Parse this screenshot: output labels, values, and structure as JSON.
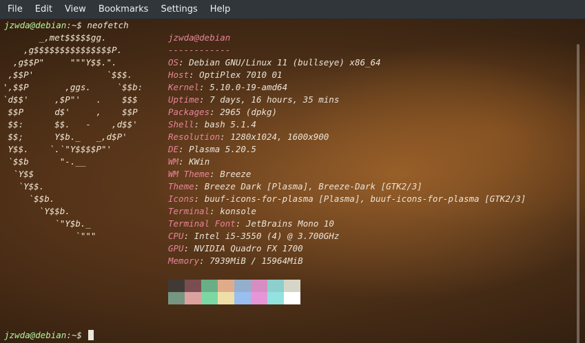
{
  "menubar": {
    "items": [
      "File",
      "Edit",
      "View",
      "Bookmarks",
      "Settings",
      "Help"
    ]
  },
  "prompt": {
    "user": "jzwda@debian",
    "path": ":~$ ",
    "command": "neofetch"
  },
  "logo": [
    "       _,met$$$$$gg.",
    "    ,g$$$$$$$$$$$$$$$P.",
    "  ,g$$P\"     \"\"\"Y$$.\".",
    " ,$$P'              `$$$.",
    "',$$P       ,ggs.     `$$b:",
    "`d$$'     ,$P\"'   .    $$$",
    " $$P      d$'     ,    $$P",
    " $$:      $$.   -    ,d$$'",
    " $$;      Y$b._   _,d$P'",
    " Y$$.    `.`\"Y$$$$P\"'",
    " `$$b      \"-.__",
    "  `Y$$",
    "   `Y$$.",
    "     `$$b.",
    "       `Y$$b.",
    "          `\"Y$b._",
    "              `\"\"\""
  ],
  "info": {
    "title": "jzwda@debian",
    "separator": "------------",
    "lines": [
      {
        "label": "OS",
        "value": "Debian GNU/Linux 11 (bullseye) x86_64"
      },
      {
        "label": "Host",
        "value": "OptiPlex 7010 01"
      },
      {
        "label": "Kernel",
        "value": "5.10.0-19-amd64"
      },
      {
        "label": "Uptime",
        "value": "7 days, 16 hours, 35 mins"
      },
      {
        "label": "Packages",
        "value": "2965 (dpkg)"
      },
      {
        "label": "Shell",
        "value": "bash 5.1.4"
      },
      {
        "label": "Resolution",
        "value": "1280x1024, 1600x900"
      },
      {
        "label": "DE",
        "value": "Plasma 5.20.5"
      },
      {
        "label": "WM",
        "value": "KWin"
      },
      {
        "label": "WM Theme",
        "value": "Breeze"
      },
      {
        "label": "Theme",
        "value": "Breeze Dark [Plasma], Breeze-Dark [GTK2/3]"
      },
      {
        "label": "Icons",
        "value": "buuf-icons-for-plasma [Plasma], buuf-icons-for-plasma [GTK2/3]"
      },
      {
        "label": "Terminal",
        "value": "konsole"
      },
      {
        "label": "Terminal Font",
        "value": "JetBrains Mono 10"
      },
      {
        "label": "CPU",
        "value": "Intel i5-3550 (4) @ 3.700GHz"
      },
      {
        "label": "GPU",
        "value": "NVIDIA Quadro FX 1700"
      },
      {
        "label": "Memory",
        "value": "7939MiB / 15964MiB"
      }
    ]
  },
  "palette": {
    "normal": [
      "#403a36",
      "#7a4e50",
      "#6aae86",
      "#e0ab8a",
      "#94afcc",
      "#d68ec2",
      "#8ccfcc",
      "#d6d6c8"
    ],
    "bright": [
      "#769682",
      "#dba2a0",
      "#7dd7a2",
      "#eedfa8",
      "#98bff0",
      "#e596d6",
      "#92e2e0",
      "#ffffff"
    ]
  },
  "final_prompt": {
    "user": "jzwda@debian",
    "path": ":~$ "
  }
}
